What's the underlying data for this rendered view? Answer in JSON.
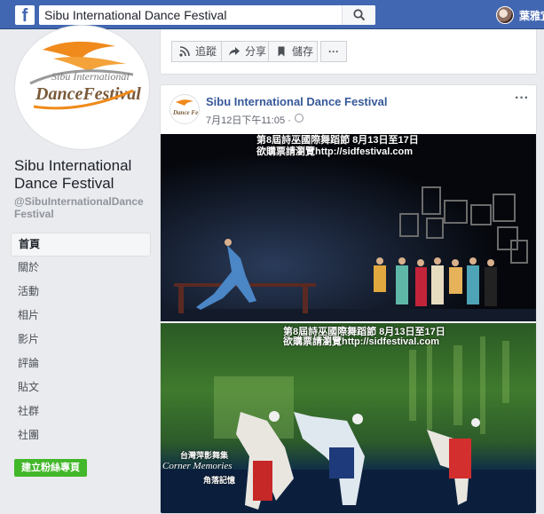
{
  "topbar": {
    "logo": "f",
    "search_value": "Sibu International Dance Festival",
    "user_name": "葉雅宜",
    "brand_color": "#4267b2"
  },
  "sidebar": {
    "logo_line1": "Sibu International",
    "logo_line2": "DanceFestival",
    "page_name": "Sibu International Dance Festival",
    "page_handle": "@SibuInternationalDanceFestival",
    "nav": [
      {
        "label": "首頁",
        "active": true
      },
      {
        "label": "關於"
      },
      {
        "label": "活動"
      },
      {
        "label": "相片"
      },
      {
        "label": "影片"
      },
      {
        "label": "評論"
      },
      {
        "label": "貼文"
      },
      {
        "label": "社群"
      },
      {
        "label": "社團"
      }
    ],
    "create_button": "建立粉絲專頁",
    "create_color": "#42b72a"
  },
  "actions": {
    "follow": "追蹤",
    "share": "分享",
    "save": "儲存",
    "more": "···"
  },
  "post": {
    "author": "Sibu International Dance Festival",
    "time": "7月12日下午11:05 ·",
    "more": "···",
    "avatar_text": "Dance Festival",
    "image1_caption1": "第8屆詩巫國際舞蹈節  8月13日至17日",
    "image1_caption2": "欲購票請瀏覽http://sidfestival.com",
    "image2_caption1": "第8屆詩巫國際舞蹈節  8月13日至17日",
    "image2_caption2": "欲購票請瀏覽http://sidfestival.com",
    "image2_company": "台灣萍影舞集",
    "image2_title_en": "Corner Memories",
    "image2_title_zh": "角落記憶"
  }
}
